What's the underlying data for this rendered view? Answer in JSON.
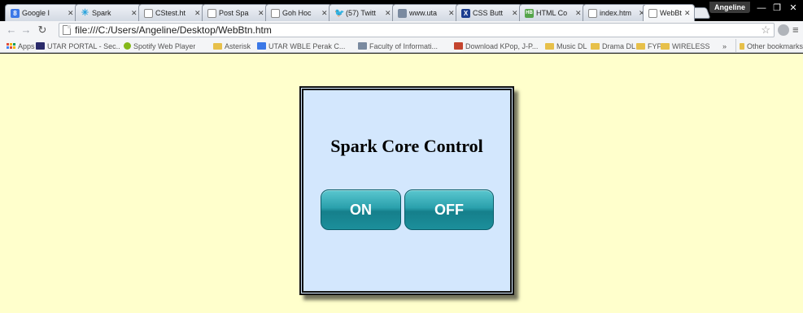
{
  "browser": {
    "tabs": [
      {
        "label": "Google I",
        "icon": "google-icon",
        "color": "#3b78e7"
      },
      {
        "label": "Spark",
        "icon": "spark-icon",
        "color": "#29a3dc"
      },
      {
        "label": "CStest.ht",
        "icon": "page-icon",
        "color": "#ffffff"
      },
      {
        "label": "Post Spa",
        "icon": "page-icon",
        "color": "#ffffff"
      },
      {
        "label": "Goh Hoc",
        "icon": "page-icon",
        "color": "#ffffff"
      },
      {
        "label": "(57) Twitt",
        "icon": "twitter-icon",
        "color": "#4aa3df"
      },
      {
        "label": "www.uta",
        "icon": "image-icon",
        "color": "#7a8aa0"
      },
      {
        "label": "CSS Butt",
        "icon": "css-icon",
        "color": "#1b3d8f"
      },
      {
        "label": "HTML Co",
        "icon": "html-icon",
        "color": "#55a54a"
      },
      {
        "label": "index.htm",
        "icon": "page-icon",
        "color": "#ffffff"
      },
      {
        "label": "WebBtn.l",
        "icon": "page-icon",
        "color": "#ffffff"
      }
    ],
    "user": "Angeline",
    "url": "file:///C:/Users/Angeline/Desktop/WebBtn.htm",
    "bookmarks": [
      {
        "label": "Apps",
        "icon": "apps-icon"
      },
      {
        "label": "UTAR PORTAL - Sec...",
        "icon": "utar-icon"
      },
      {
        "label": "Spotify Web Player",
        "icon": "spotify-icon"
      },
      {
        "label": "Asterisk",
        "icon": "folder-icon"
      },
      {
        "label": "UTAR WBLE Perak C...",
        "icon": "wble-icon"
      },
      {
        "label": "Faculty of Informati...",
        "icon": "faculty-icon"
      },
      {
        "label": "Download KPop, J-P...",
        "icon": "kpop-icon"
      },
      {
        "label": "Music DL",
        "icon": "folder-icon"
      },
      {
        "label": "Drama DL",
        "icon": "folder-icon"
      },
      {
        "label": "FYP",
        "icon": "folder-icon"
      },
      {
        "label": "WIRELESS",
        "icon": "folder-icon"
      },
      {
        "label": "»",
        "icon": "more-icon"
      },
      {
        "label": "Other bookmarks",
        "icon": "folder-icon"
      }
    ]
  },
  "page": {
    "title": "Spark Core Control",
    "on_label": "ON",
    "off_label": "OFF"
  }
}
